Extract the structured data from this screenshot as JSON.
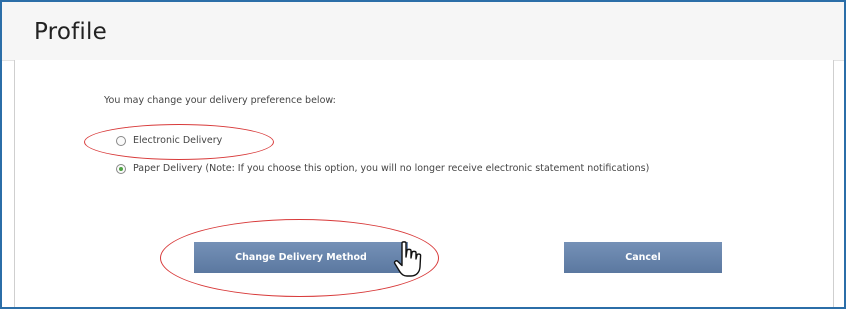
{
  "header": {
    "title": "Profile"
  },
  "delivery": {
    "instructions": "You may change your delivery preference below:",
    "options": [
      {
        "label": "Electronic Delivery",
        "selected": false
      },
      {
        "label": "Paper Delivery (Note: If you choose this option, you will no longer receive electronic statement notifications)",
        "selected": true
      }
    ]
  },
  "buttons": {
    "change_label": "Change Delivery Method",
    "cancel_label": "Cancel"
  },
  "colors": {
    "frame_border": "#2b6ea8",
    "button_fill": "#6683ab",
    "highlight": "#d83a3a",
    "radio_selected": "#4fa344"
  },
  "icons": {
    "cursor": "hand-pointer-icon"
  }
}
